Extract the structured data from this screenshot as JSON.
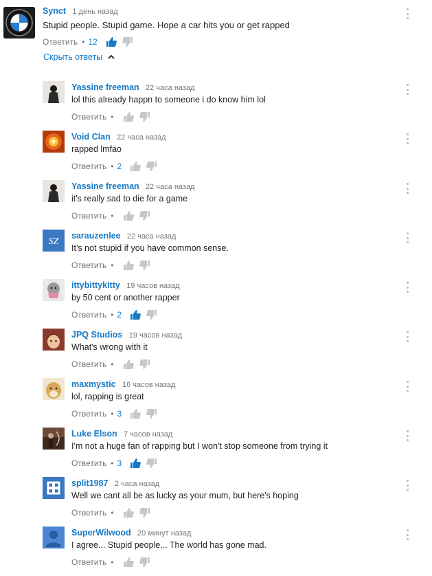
{
  "main_comment": {
    "author": "Synct",
    "time": "1 день назад",
    "text": "Stupid people. Stupid game. Hope a car hits you or get rapped",
    "reply_label": "Ответить",
    "dot": "•",
    "likes": "12",
    "liked": true,
    "avatar_icon": "bmw-logo-icon"
  },
  "toggle": {
    "label": "Скрыть ответы",
    "icon": "chevron-up-icon"
  },
  "replies": [
    {
      "author": "Yassine freeman",
      "time": "22 часа назад",
      "text": "lol this already happn to someone i do know him lol",
      "reply_label": "Ответить",
      "dot": "•",
      "likes": "",
      "liked": false,
      "avatar_icon": "person-photo-icon",
      "avatar_bg": "#2b2b2b"
    },
    {
      "author": "Void Clan",
      "time": "22 часа назад",
      "text": "rapped lmfao",
      "reply_label": "Ответить",
      "dot": "•",
      "likes": "2",
      "liked": false,
      "avatar_icon": "fire-emblem-icon",
      "avatar_bg": "#b23a0c"
    },
    {
      "author": "Yassine freeman",
      "time": "22 часа назад",
      "text": "it's really sad to die for a game",
      "reply_label": "Ответить",
      "dot": "•",
      "likes": "",
      "liked": false,
      "avatar_icon": "person-photo-icon",
      "avatar_bg": "#2b2b2b"
    },
    {
      "author": "sarauzenlee",
      "time": "22 часа назад",
      "text": "It's not stupid if you have common sense.",
      "reply_label": "Ответить",
      "dot": "•",
      "likes": "",
      "liked": false,
      "avatar_icon": "sz-monogram-icon",
      "avatar_bg": "#3a78c0",
      "avatar_text": "SZ"
    },
    {
      "author": "ittybittykitty",
      "time": "19 часов назад",
      "text": "by 50 cent or another rapper",
      "reply_label": "Ответить",
      "dot": "•",
      "likes": "2",
      "liked": true,
      "avatar_icon": "cat-cupcake-icon",
      "avatar_bg": "#e9e9e9"
    },
    {
      "author": "JPQ Studios",
      "time": "19 часов назад",
      "text": "What's wrong with it",
      "reply_label": "Ответить",
      "dot": "•",
      "likes": "",
      "liked": false,
      "avatar_icon": "cartoon-face-icon",
      "avatar_bg": "#8a3a2a"
    },
    {
      "author": "maxmystic",
      "time": "16 часов назад",
      "text": "lol, rapping is great",
      "reply_label": "Ответить",
      "dot": "•",
      "likes": "3",
      "liked": false,
      "avatar_icon": "doge-icon",
      "avatar_bg": "#d9a75b"
    },
    {
      "author": "Luke Elson",
      "time": "7 часов назад",
      "text": "I'm not a huge fan of rapping but I won't stop someone from trying it",
      "reply_label": "Ответить",
      "dot": "•",
      "likes": "3",
      "liked": true,
      "avatar_icon": "archer-photo-icon",
      "avatar_bg": "#3f2a20"
    },
    {
      "author": "split1987",
      "time": "2 часа назад",
      "text": "Well we cant all be as lucky as your mum, but here's hoping",
      "reply_label": "Ответить",
      "dot": "•",
      "likes": "",
      "liked": false,
      "avatar_icon": "grid-pattern-icon",
      "avatar_bg": "#3a78c0"
    },
    {
      "author": "SuperWilwood",
      "time": "20 минут назад",
      "text": "I agree... Stupid people... The world has gone mad.",
      "reply_label": "Ответить",
      "dot": "•",
      "likes": "",
      "liked": false,
      "avatar_icon": "default-user-icon",
      "avatar_bg": "#4a86d4"
    }
  ],
  "colors": {
    "link": "#167ac6",
    "muted": "#767676",
    "thumb_inactive": "#c7c7c7"
  }
}
